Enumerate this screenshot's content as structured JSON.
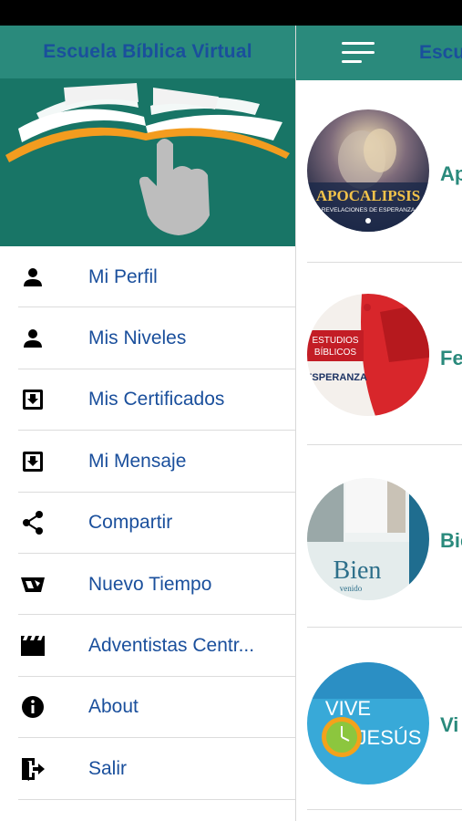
{
  "drawer": {
    "title": "Escuela Bíblica Virtual",
    "items": [
      {
        "label": "Mi Perfil",
        "icon": "person-icon"
      },
      {
        "label": "Mis Niveles",
        "icon": "person-icon"
      },
      {
        "label": "Mis Certificados",
        "icon": "inbox-download-icon"
      },
      {
        "label": "Mi Mensaje",
        "icon": "inbox-download-icon"
      },
      {
        "label": "Compartir",
        "icon": "share-icon"
      },
      {
        "label": "Nuevo Tiempo",
        "icon": "nuevo-tiempo-logo-icon"
      },
      {
        "label": "Adventistas Centr...",
        "icon": "clapperboard-icon"
      },
      {
        "label": "About",
        "icon": "info-icon"
      },
      {
        "label": "Salir",
        "icon": "exit-icon"
      }
    ]
  },
  "main": {
    "title": "Escu",
    "courses": [
      {
        "title": "Ap",
        "thumb_text": [
          "APOCALIPSIS",
          "REVELACIONES DE ESPERANZA"
        ]
      },
      {
        "title": "Fe",
        "thumb_text": [
          "ESTUDIOS",
          "BÍBLICOS",
          "ESPERANZA"
        ]
      },
      {
        "title": "Bie",
        "thumb_text": [
          "Bien",
          "venido"
        ]
      },
      {
        "title": "Vi",
        "thumb_text": [
          "VIVE",
          "JESÚS"
        ]
      }
    ]
  },
  "colors": {
    "header_teal": "#2a8a7c",
    "banner_teal": "#187566",
    "label_blue": "#1a4f9c",
    "accent_orange": "#f39c1f"
  }
}
